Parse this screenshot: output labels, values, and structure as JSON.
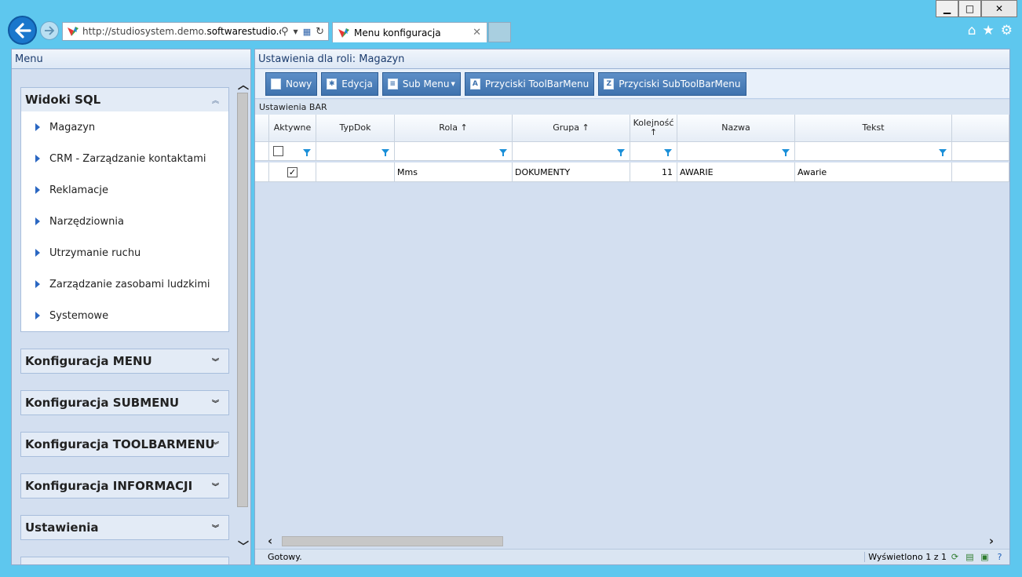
{
  "browser": {
    "url_prefix": "http://studiosystem.demo.",
    "url_domain": "softwarestudio.c",
    "url_suffix": "...",
    "tab_title": "Menu konfiguracja"
  },
  "left_panel": {
    "title": "Menu",
    "groups": [
      {
        "title": "Widoki SQL",
        "expanded": true,
        "items": [
          "Magazyn",
          "CRM - Zarządzanie kontaktami",
          "Reklamacje",
          "Narzędziownia",
          "Utrzymanie ruchu",
          "Zarządzanie zasobami ludzkimi",
          "Systemowe"
        ]
      },
      {
        "title": "Konfiguracja MENU",
        "expanded": false
      },
      {
        "title": "Konfiguracja SUBMENU",
        "expanded": false
      },
      {
        "title": "Konfiguracja TOOLBARMENU",
        "expanded": false
      },
      {
        "title": "Konfiguracja INFORMACJI",
        "expanded": false
      },
      {
        "title": "Ustawienia",
        "expanded": false
      }
    ]
  },
  "right_panel": {
    "title": "Ustawienia dla roli: Magazyn",
    "toolbar": {
      "new": "Nowy",
      "edit": "Edycja",
      "submenu": "Sub Menu",
      "toolbar_buttons": "Przyciski ToolBarMenu",
      "subtoolbar_buttons": "Przyciski SubToolBarMenu"
    },
    "grid_caption": "Ustawienia BAR",
    "columns": [
      "Aktywne",
      "TypDok",
      "Rola ↑",
      "Grupa ↑",
      "Kolejność ↑",
      "Nazwa",
      "Tekst"
    ],
    "rows": [
      {
        "aktywne": true,
        "typdok": "",
        "rola": "Mms",
        "grupa": "DOKUMENTY",
        "kolejnosc": "11",
        "nazwa": "AWARIE",
        "tekst": "Awarie"
      }
    ],
    "status_left": "Gotowy.",
    "status_right": "Wyświetlono 1 z 1"
  },
  "colors": {
    "chrome": "#5ec7ee",
    "panel": "#d3dff0",
    "button": "#4a7fbb",
    "header_text": "#1c3c6e"
  }
}
